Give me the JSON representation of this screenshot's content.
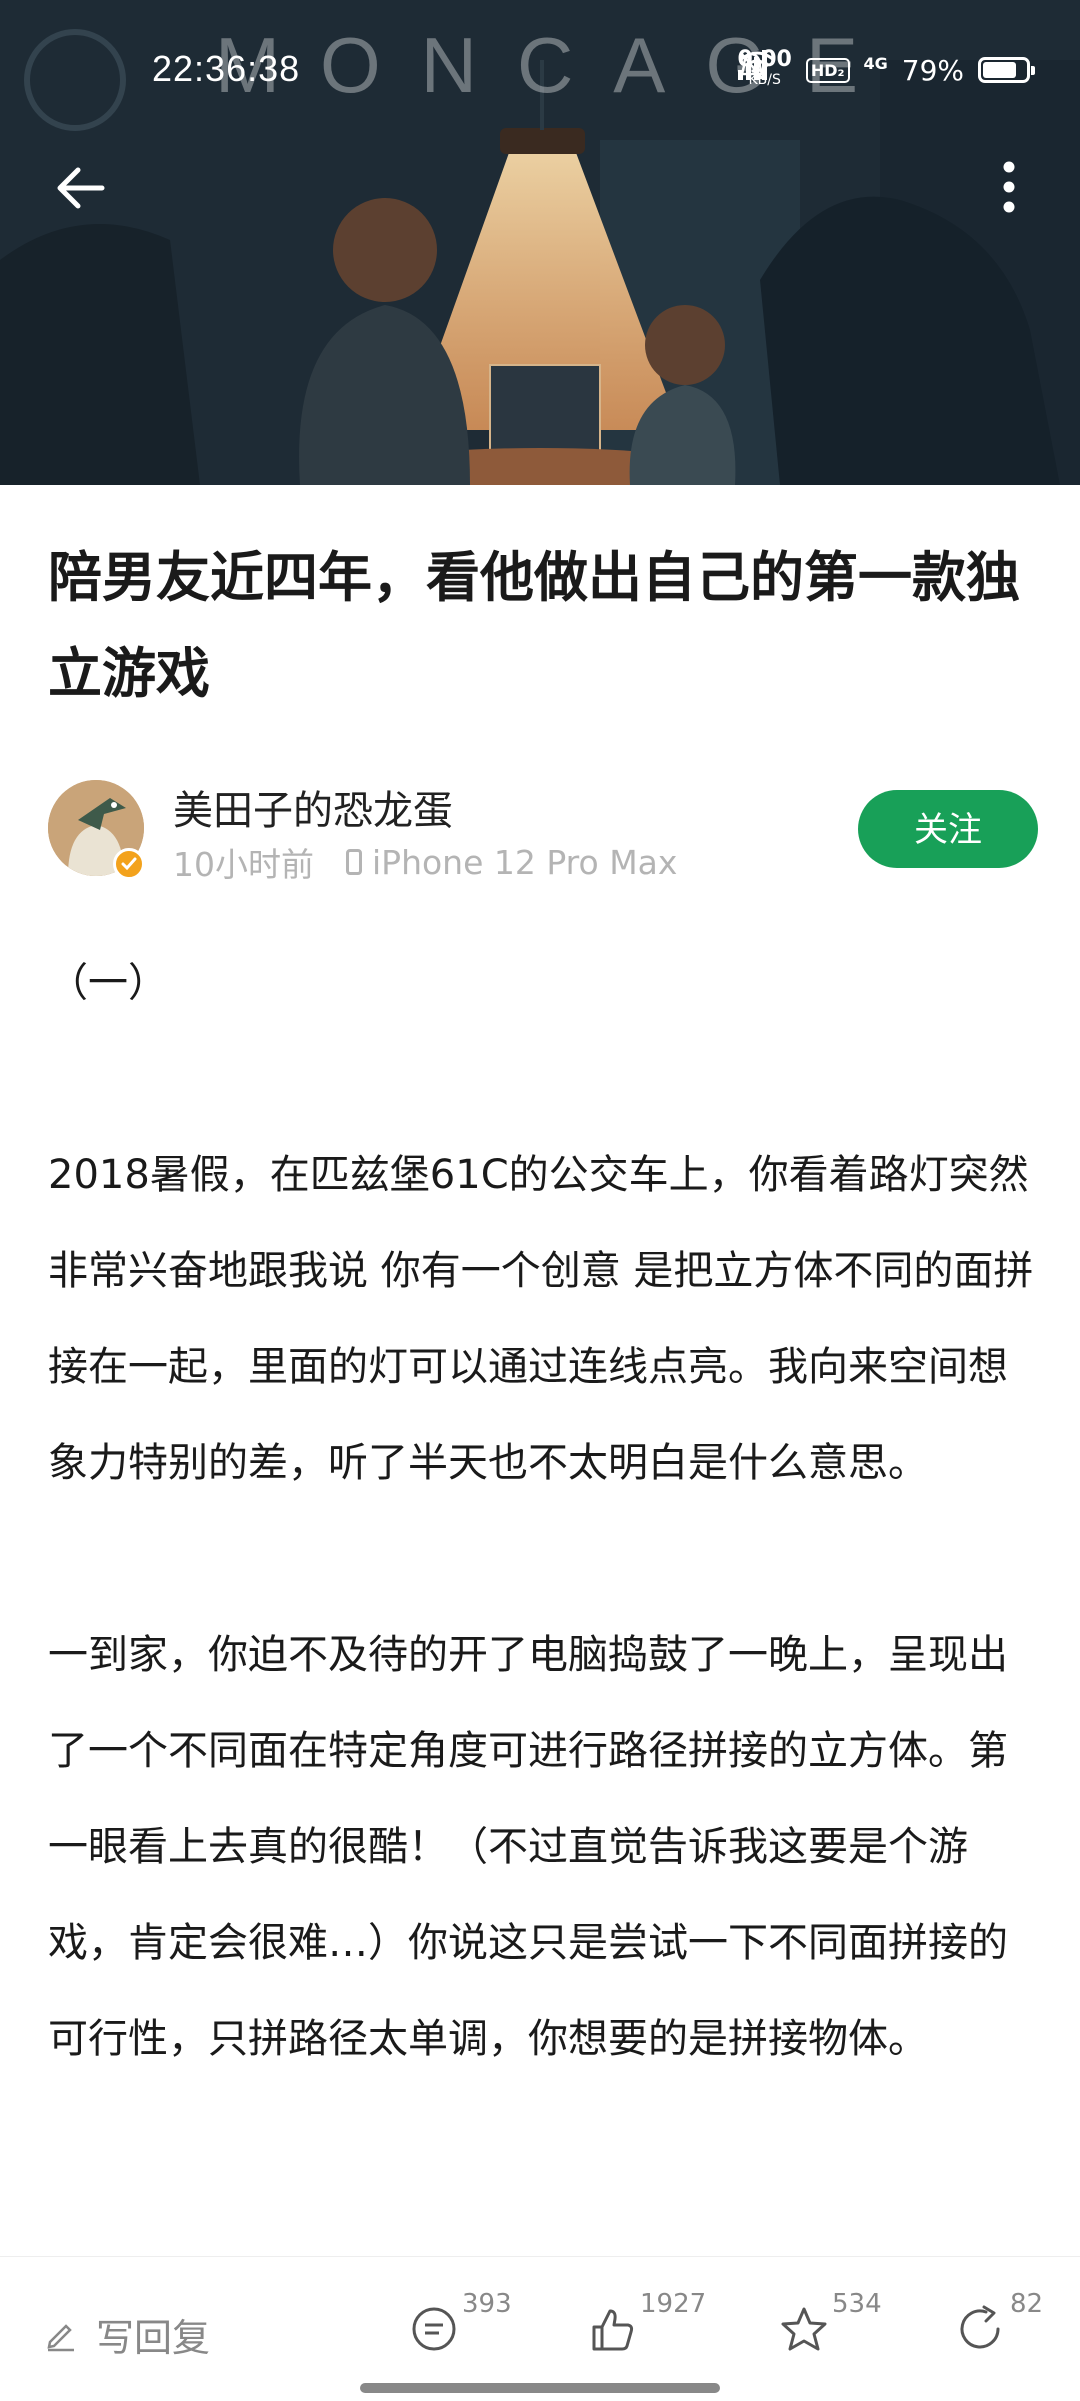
{
  "status_bar": {
    "time": "22:36:38",
    "banner_brand": "MONCAGE",
    "speed_value": "0.00",
    "speed_unit": "KB/S",
    "hd_badge": "HD₂",
    "network": "4G",
    "battery_percent": "79%"
  },
  "header": {
    "back_icon": "arrow-left-icon",
    "more_icon": "vertical-dots-icon"
  },
  "article": {
    "title": "陪男友近四年，看他做出自己的第一款独立游戏",
    "author": {
      "name": "美田子的恐龙蛋",
      "time": "10小时前",
      "device": "iPhone 12 Pro Max",
      "follow_label": "关注"
    },
    "paragraphs": [
      "（一）",
      "",
      "2018暑假，在匹兹堡61C的公交车上，你看着路灯突然非常兴奋地跟我说 你有一个创意 是把立方体不同的面拼接在一起，里面的灯可以通过连线点亮。我向来空间想象力特别的差，听了半天也不太明白是什么意思。",
      "",
      "一到家，你迫不及待的开了电脑捣鼓了一晚上，呈现出了一个不同面在特定角度可进行路径拼接的立方体。第一眼看上去真的很酷！（不过直觉告诉我这要是个游戏，肯定会很难…）你说这只是尝试一下不同面拼接的可行性，只拼路径太单调，你想要的是拼接物体。"
    ]
  },
  "toolbar": {
    "reply_label": "写回复",
    "comments": "393",
    "likes": "1927",
    "favorites": "534",
    "shares": "82"
  }
}
